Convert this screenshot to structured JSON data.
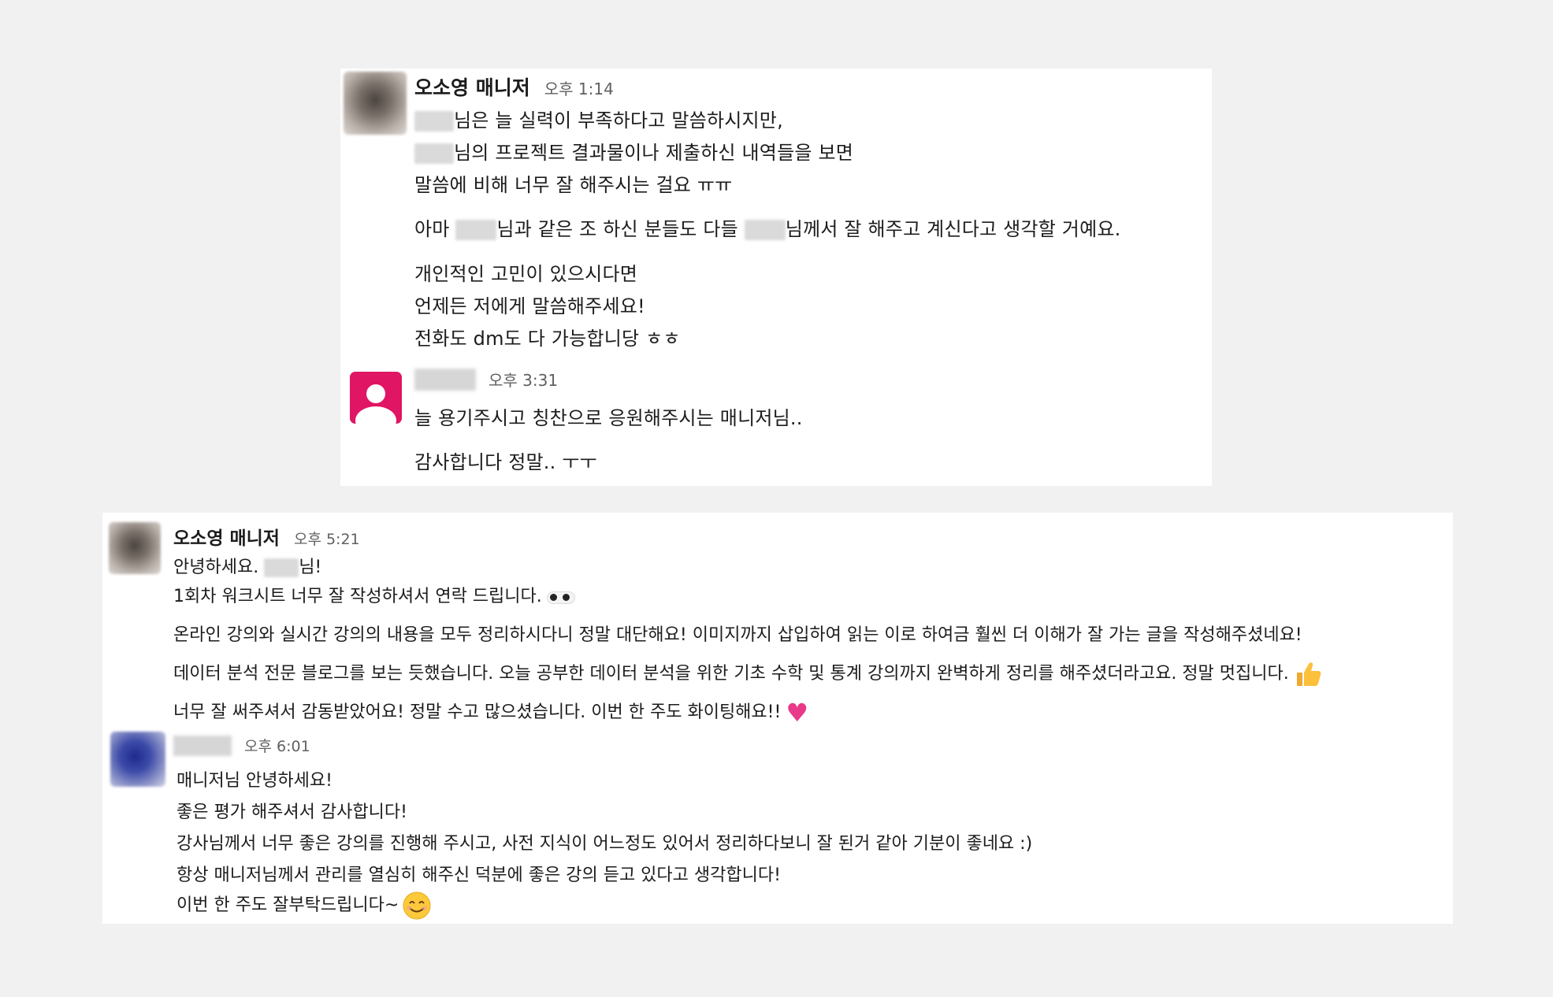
{
  "card1": {
    "msg1": {
      "author": "오소영 매니저",
      "time": "오후 1:14",
      "lines": {
        "l1_after": "님은 늘 실력이 부족하다고 말씀하시지만,",
        "l2_after": "님의 프로젝트 결과물이나 제출하신 내역들을 보면",
        "l3": "말씀에 비해 너무 잘 해주시는 걸요 ㅠㅠ",
        "l4_a": "아마 ",
        "l4_b": "님과 같은 조 하신 분들도 다들 ",
        "l4_c": "님께서 잘 해주고 계신다고 생각할 거예요.",
        "l5": "개인적인 고민이 있으시다면",
        "l6": "언제든 저에게 말씀해주세요!",
        "l7": "전화도 dm도 다 가능합니당 ㅎㅎ"
      }
    },
    "msg2": {
      "time": "오후 3:31",
      "l1": "늘 용기주시고 칭찬으로 응원해주시는 매니저님..",
      "l2": "감사합니다 정말.. ㅜㅜ"
    }
  },
  "card2": {
    "msg1": {
      "author": "오소영 매니저",
      "time": "오후 5:21",
      "l1_a": "안녕하세요. ",
      "l1_b": "님!",
      "l2": "1회차 워크시트 너무 잘 작성하셔서 연락 드립니다.",
      "l3": "온라인 강의와 실시간 강의의 내용을 모두 정리하시다니 정말 대단해요! 이미지까지 삽입하여 읽는 이로 하여금 훨씬 더 이해가 잘 가는 글을 작성해주셨네요!",
      "l4": "데이터 분석 전문 블로그를 보는 듯했습니다. 오늘 공부한 데이터 분석을 위한 기초 수학 및 통계 강의까지 완벽하게 정리를 해주셨더라고요. 정말 멋집니다.",
      "l5": "너무 잘 써주셔서 감동받았어요! 정말 수고 많으셨습니다. 이번 한 주도 화이팅해요!!"
    },
    "msg2": {
      "time": "오후 6:01",
      "l1": "매니저님 안녕하세요!",
      "l2": "좋은 평가 해주셔서 감사합니다!",
      "l3": "강사님께서 너무 좋은 강의를 진행해 주시고, 사전 지식이 어느정도 있어서 정리하다보니 잘 된거 같아 기분이 좋네요 :)",
      "l4": "항상 매니저님께서 관리를 열심히 해주신 덕분에 좋은 강의 듣고 있다고 생각합니다!",
      "l5": "이번 한 주도 잘부탁드립니다~"
    }
  },
  "icons": {
    "panda": "panda-emoji",
    "heart": "heart-emoji",
    "thumbs_up": "thumbs-up-emoji",
    "smile": "smile-emoji"
  }
}
